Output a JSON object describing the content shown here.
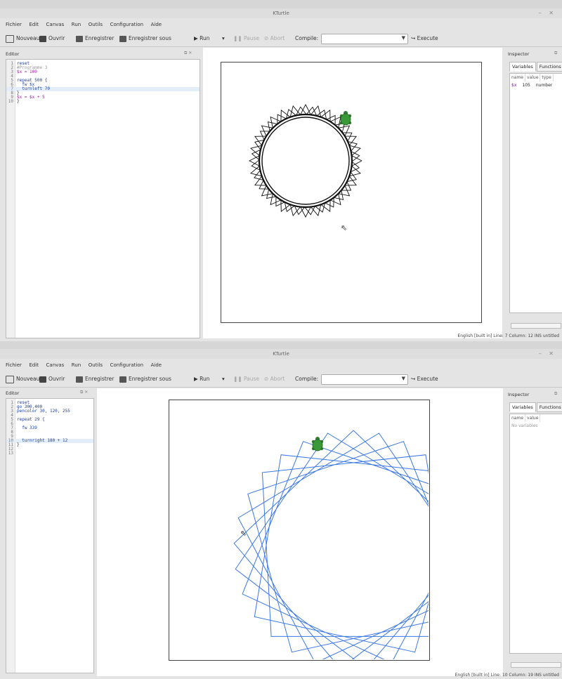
{
  "window_title": "KTurtle",
  "menu": [
    "Fichier",
    "Edit",
    "Canvas",
    "Run",
    "Outils",
    "Configuration",
    "Aide"
  ],
  "toolbar": {
    "new": "Nouveau",
    "open": "Ouvrir",
    "save": "Enregistrer",
    "save_as": "Enregistrer sous",
    "run": "Run",
    "pause": "Pause",
    "abort": "Abort",
    "compile_label": "Compile:",
    "compile_value": "",
    "execute": "Execute"
  },
  "editor_title": "Editor",
  "inspector_title": "Inspector",
  "inspector_tabs": [
    "Variables",
    "Functions"
  ],
  "inspector_headers": [
    "name",
    "value",
    "type"
  ],
  "colors": {
    "pen_top": "#111111",
    "pen_bottom": "#3a78e8",
    "turtle": "#3a9a3a"
  },
  "windows": [
    {
      "code": [
        {
          "n": "1",
          "t": "reset"
        },
        {
          "n": "2",
          "t": "#Programme 3"
        },
        {
          "n": "3",
          "t": "$x = 100"
        },
        {
          "n": "4",
          "t": ""
        },
        {
          "n": "5",
          "t": "repeat 500 {"
        },
        {
          "n": "6",
          "t": "  fw $x"
        },
        {
          "n": "7",
          "t": "  turnleft 70"
        },
        {
          "n": "8",
          "t": "}"
        },
        {
          "n": "9",
          "t": "$x = $x + 5"
        },
        {
          "n": "10",
          "t": "}"
        }
      ],
      "inspector_rows": [
        {
          "name": "$x",
          "value": "105",
          "type": "number"
        }
      ],
      "status": "English [built in]   Line: 7  Column: 12   INS   untitled"
    },
    {
      "code": [
        {
          "n": "1",
          "t": "reset"
        },
        {
          "n": "2",
          "t": "go 300,400"
        },
        {
          "n": "3",
          "t": "pencolor 30, 120, 255"
        },
        {
          "n": "4",
          "t": ""
        },
        {
          "n": "5",
          "t": "repeat 29 {"
        },
        {
          "n": "6",
          "t": ""
        },
        {
          "n": "7",
          "t": "  fw 339"
        },
        {
          "n": "8",
          "t": ""
        },
        {
          "n": "9",
          "t": ""
        },
        {
          "n": "10",
          "t": "  turnright 180 + 12"
        },
        {
          "n": "11",
          "t": "}"
        },
        {
          "n": "12",
          "t": ""
        },
        {
          "n": "13",
          "t": ""
        }
      ],
      "inspector_rows": [],
      "inspector_empty": "No variables",
      "status": "English [built in]   Line: 10  Column: 19   INS   untitled"
    }
  ]
}
